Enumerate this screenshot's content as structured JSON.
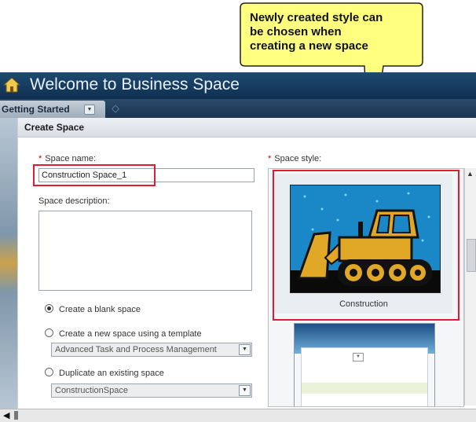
{
  "app": {
    "title": "Welcome to Business Space"
  },
  "tabs": {
    "active": "Getting Started"
  },
  "dialog": {
    "title": "Create Space",
    "space_name_label": "Space name:",
    "space_name_value": "Construction Space_1",
    "space_description_label": "Space description:",
    "space_style_label": "Space style:",
    "options": [
      {
        "label": "Create a blank space",
        "selected": true
      },
      {
        "label": "Create a new space using a template",
        "selected": false
      },
      {
        "label": "Duplicate an existing space",
        "selected": false
      }
    ],
    "template_select_value": "Advanced Task and Process Management",
    "existing_space_select_value": "ConstructionSpace",
    "styles": [
      {
        "name": "Construction"
      }
    ]
  },
  "callout": {
    "lines": [
      "Newly created style can",
      "be chosen when",
      "creating a new space"
    ],
    "fill": "#ffff7f"
  },
  "colors": {
    "highlight": "#e21b2e",
    "titlebar": "#173d62"
  }
}
